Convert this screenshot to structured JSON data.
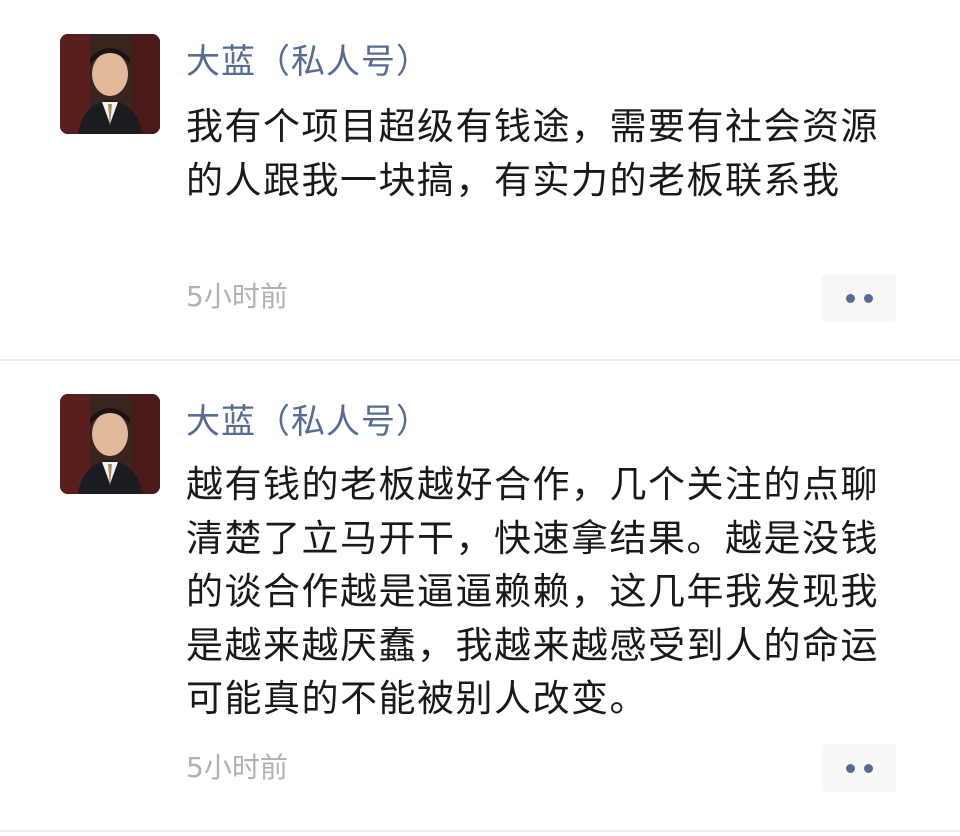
{
  "moments": [
    {
      "author": "大蓝（私人号）",
      "text": "我有个项目超级有钱途，需要有社会资源的人跟我一块搞，有实力的老板联系我",
      "time": "5小时前",
      "more_icon": "two-dots-more-icon"
    },
    {
      "author": "大蓝（私人号）",
      "text": "越有钱的老板越好合作，几个关注的点聊清楚了立马开干，快速拿结果。越是没钱的谈合作越是逼逼赖赖，这几年我发现我是越来越厌蠢，我越来越感受到人的命运可能真的不能被别人改变。",
      "time": "5小时前",
      "more_icon": "two-dots-more-icon"
    }
  ],
  "colors": {
    "author_name": "#576b95",
    "body_text": "#191919",
    "timestamp": "#b2b2b2",
    "more_button_bg": "#f7f7f7",
    "divider": "#ececec"
  }
}
